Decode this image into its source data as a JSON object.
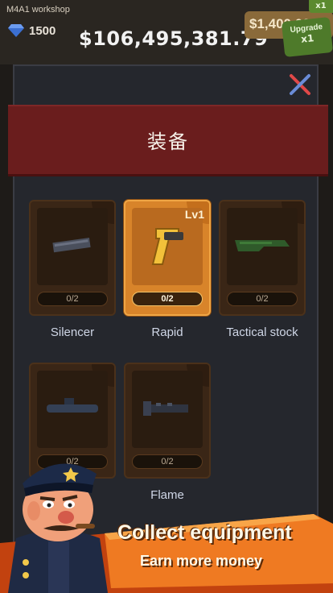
{
  "hud": {
    "workshop_name": "M4A1 workshop",
    "gems": "1500",
    "money_total": "$106,495,381.79",
    "money_button": "$1,400,000",
    "upgrade_label": "Upgrade",
    "upgrade_multiplier": "x1",
    "multiplier_tag": "x1"
  },
  "modal": {
    "title": "装备",
    "close_icon": "close-x-icon"
  },
  "equipment": [
    {
      "name": "Silencer",
      "progress": "0/2",
      "level": "",
      "active": false,
      "icon": "silencer-icon"
    },
    {
      "name": "Rapid",
      "progress": "0/2",
      "level": "Lv1",
      "active": true,
      "icon": "rapid-magazine-icon"
    },
    {
      "name": "Tactical stock",
      "progress": "0/2",
      "level": "",
      "active": false,
      "icon": "tactical-stock-icon"
    },
    {
      "name": "",
      "progress": "0/2",
      "level": "",
      "active": false,
      "icon": "scope-icon"
    },
    {
      "name": "Flame",
      "progress": "0/2",
      "level": "",
      "active": false,
      "icon": "flame-suppressor-icon"
    }
  ],
  "promo": {
    "title": "Collect equipment",
    "subtitle": "Earn more money"
  },
  "colors": {
    "header_band": "#6a1d1d",
    "active_card": "#d8842a",
    "inactive_card": "#3a2616",
    "promo_orange": "#e86a1c"
  }
}
